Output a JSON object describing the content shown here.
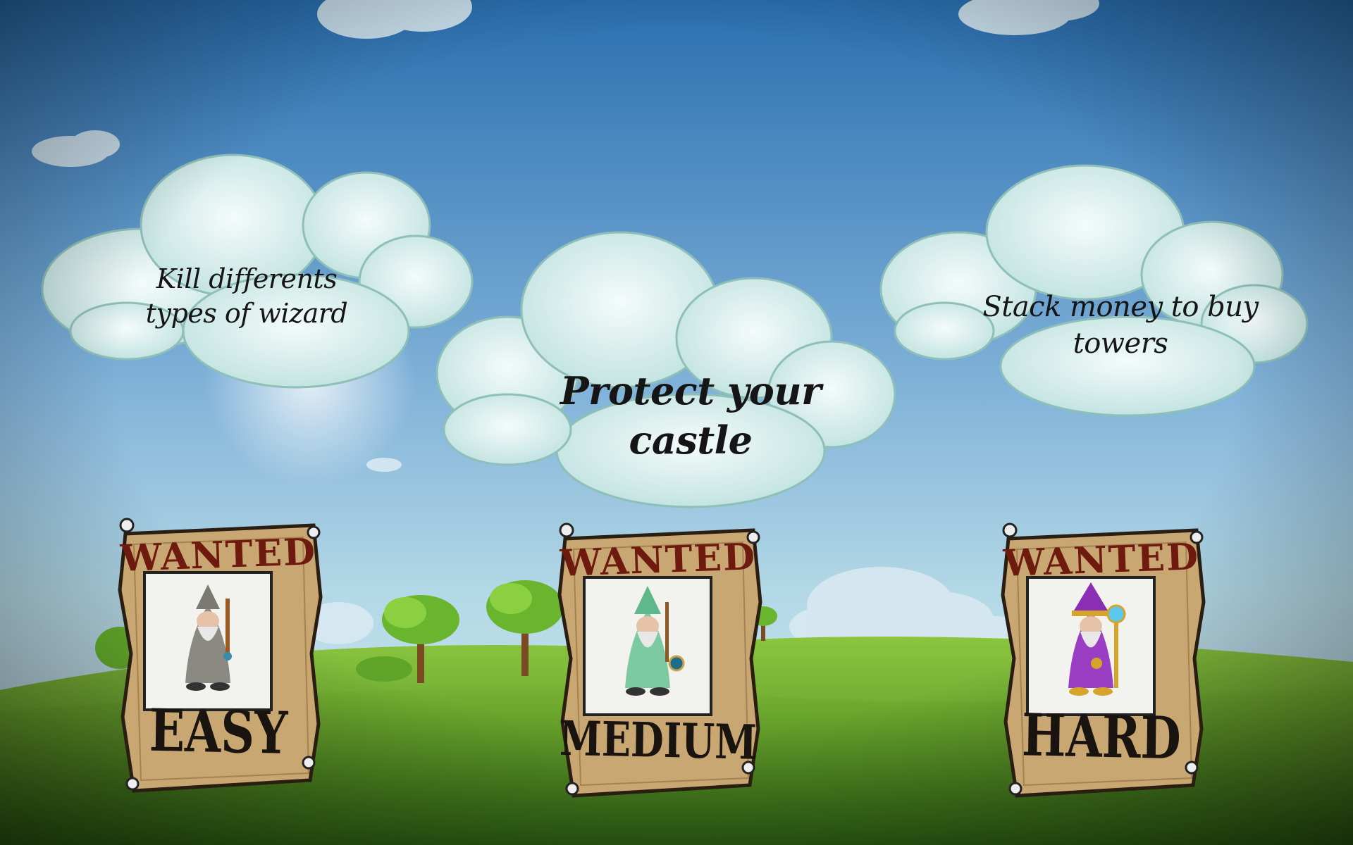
{
  "tips": {
    "kill_wizards": "Kill differents types of wizard",
    "protect": "Protect your castle",
    "stack_money": "Stack money to buy towers"
  },
  "difficulty": [
    {
      "header": "WANTED",
      "label": "EASY",
      "wizard_color": "#8a8a82"
    },
    {
      "header": "WANTED",
      "label": "MEDIUM",
      "wizard_color": "#7dc9a0"
    },
    {
      "header": "WANTED",
      "label": "HARD",
      "wizard_color": "#9a3fc4"
    }
  ],
  "colors": {
    "sky_top": "#2b74b8",
    "sky_bottom": "#a9d3e6",
    "grass": "#6aa83a",
    "cloud": "#dff1f0",
    "poster": "#c9a773",
    "wanted_text": "#6e1a0f"
  }
}
